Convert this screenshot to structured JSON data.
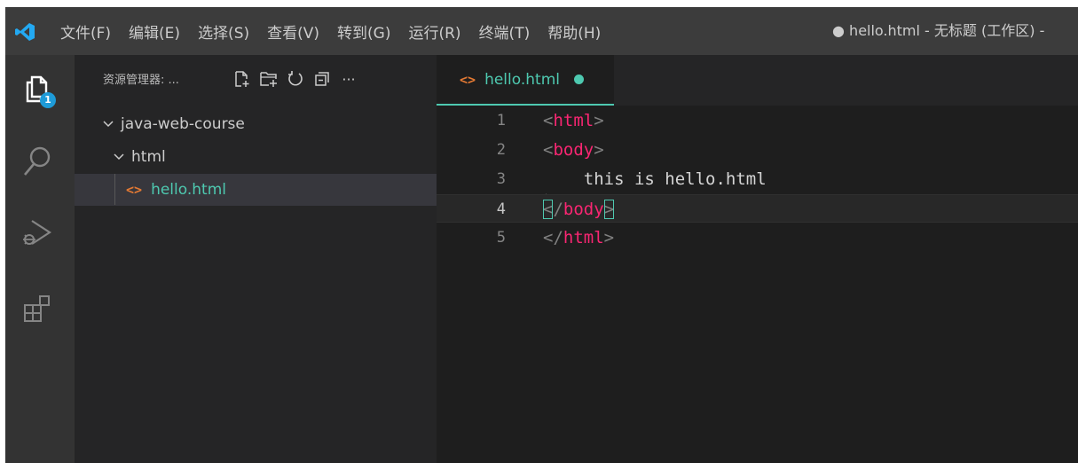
{
  "titlebar": {
    "menu": [
      "文件(F)",
      "编辑(E)",
      "选择(S)",
      "查看(V)",
      "转到(G)",
      "运行(R)",
      "终端(T)",
      "帮助(H)"
    ],
    "title": "● hello.html - 无标题 (工作区) -"
  },
  "activity": {
    "explorer_badge": "1"
  },
  "sidebar": {
    "title": "资源管理器: ...",
    "actions_more": "···",
    "tree": {
      "root": "java-web-course",
      "folder": "html",
      "file": "hello.html"
    }
  },
  "editor": {
    "tab_label": "hello.html",
    "file_icon": "<>",
    "lines": [
      {
        "number": "1",
        "parts": [
          {
            "t": "<",
            "c": "br"
          },
          {
            "t": "html",
            "c": "tg"
          },
          {
            "t": ">",
            "c": "br"
          }
        ]
      },
      {
        "number": "2",
        "parts": [
          {
            "t": "<",
            "c": "br"
          },
          {
            "t": "body",
            "c": "tg"
          },
          {
            "t": ">",
            "c": "br"
          }
        ]
      },
      {
        "number": "3",
        "parts": [
          {
            "t": "    this is hello.html",
            "c": "txt"
          }
        ]
      },
      {
        "number": "4",
        "current": true,
        "parts": [
          {
            "t": "<",
            "c": "br match"
          },
          {
            "t": "/",
            "c": "br"
          },
          {
            "t": "body",
            "c": "tg"
          },
          {
            "t": ">",
            "c": "br match"
          }
        ]
      },
      {
        "number": "5",
        "parts": [
          {
            "t": "</",
            "c": "br"
          },
          {
            "t": "html",
            "c": "tg"
          },
          {
            "t": ">",
            "c": "br"
          }
        ]
      }
    ]
  },
  "colors": {
    "accent": "#4ec9b0",
    "tag": "#f92672",
    "file_icon": "#e37933",
    "badge": "#1e9bd8"
  }
}
